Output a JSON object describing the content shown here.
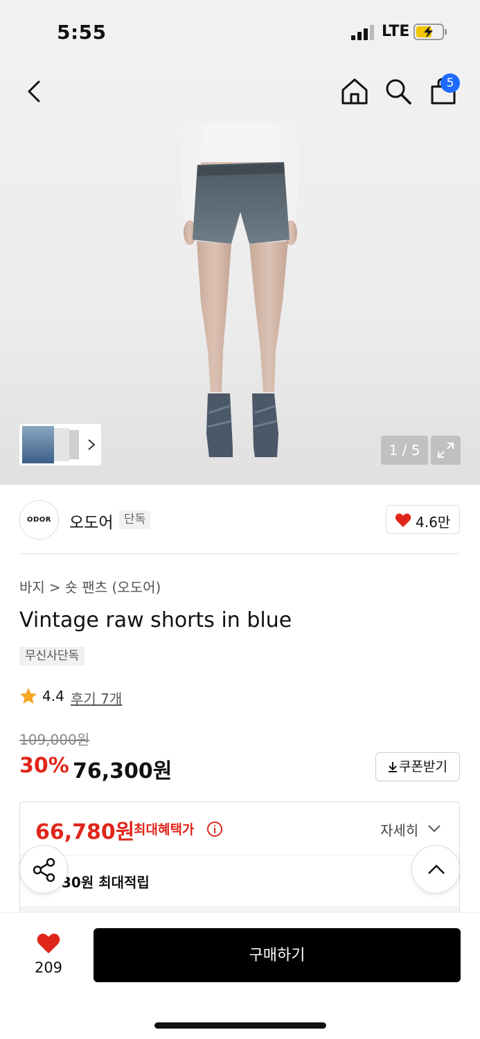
{
  "status_bar": {
    "time": "5:55",
    "network": "LTE"
  },
  "nav": {
    "cart_count": "5"
  },
  "gallery": {
    "counter": "1 / 5"
  },
  "brand": {
    "logo_text": "ODOR",
    "name": "오도어",
    "tag": "단독",
    "likes": "4.6만"
  },
  "product": {
    "breadcrumb": [
      "바지",
      ">",
      "숏 팬츠 (오도어)"
    ],
    "title": "Vintage raw shorts in blue",
    "exclusive_tag": "무신사단독",
    "rating": "4.4",
    "reviews": "후기 7개",
    "original_price": "109,000원",
    "discount": "30%",
    "sale_price": "76,300원",
    "coupon_label": "쿠폰받기"
  },
  "benefit": {
    "max_price": "66,780원",
    "max_label": "최대혜택가",
    "detail_label": "자세히",
    "points_text": "30원 최대적립"
  },
  "bottom_bar": {
    "like_count": "209",
    "buy_label": "구매하기"
  },
  "colors": {
    "accent_red": "#e0261b",
    "badge_blue": "#1e6bff",
    "buy_button": "#000000"
  },
  "icons": [
    "back-icon",
    "home-icon",
    "search-icon",
    "bag-icon",
    "chevron-right-icon",
    "expand-icon",
    "heart-icon",
    "star-icon",
    "download-icon",
    "info-icon",
    "chevron-down-icon",
    "share-icon",
    "chevron-up-icon"
  ]
}
